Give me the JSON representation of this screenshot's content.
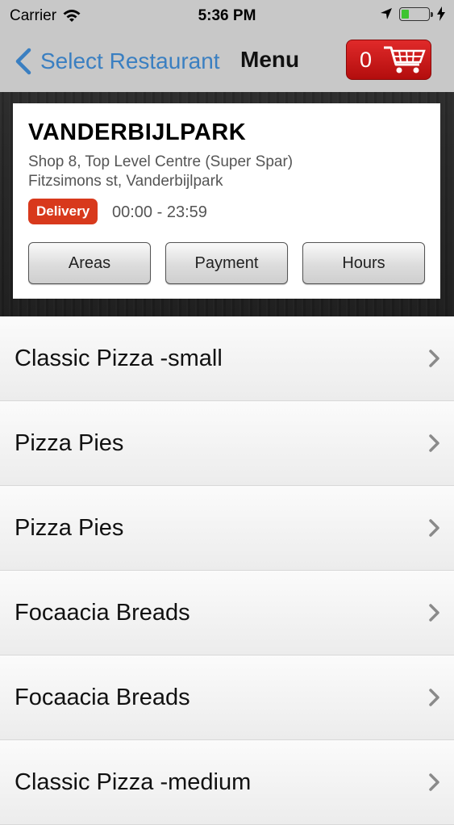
{
  "status": {
    "carrier": "Carrier",
    "time": "5:36 PM",
    "battery_level": 0.3
  },
  "nav": {
    "back_label": "Select Restaurant",
    "title": "Menu",
    "cart_count": "0"
  },
  "restaurant": {
    "name": "VANDERBIJLPARK",
    "address_line1": "Shop 8, Top Level Centre (Super Spar)",
    "address_line2": "Fitzsimons st, Vanderbijlpark",
    "badge": "Delivery",
    "hours": "00:00 - 23:59",
    "buttons": {
      "areas": "Areas",
      "payment": "Payment",
      "hours": "Hours"
    }
  },
  "menu": {
    "items": [
      {
        "label": "Classic Pizza -small"
      },
      {
        "label": "Pizza Pies"
      },
      {
        "label": "Pizza Pies"
      },
      {
        "label": "Focaacia Breads"
      },
      {
        "label": "Focaacia Breads"
      },
      {
        "label": "Classic Pizza -medium"
      }
    ]
  },
  "colors": {
    "accent_blue": "#3a7fc1",
    "cart_red": "#d0181a",
    "badge_red": "#d8391c",
    "battery_green": "#3ec430"
  }
}
